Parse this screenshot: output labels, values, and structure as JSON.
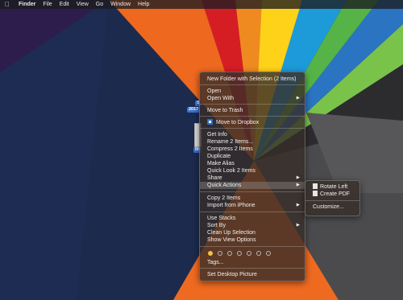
{
  "menubar": {
    "apple_icon": "apple-icon",
    "app": "Finder",
    "menus": [
      "File",
      "Edit",
      "View",
      "Go",
      "Window",
      "Help"
    ]
  },
  "desktop": {
    "labels": [
      "S",
      "2017",
      "IM"
    ]
  },
  "context_menu": {
    "new_folder": "New Folder with Selection (2 Items)",
    "open": "Open",
    "open_with": "Open With",
    "move_to_trash": "Move to Trash",
    "move_to_dropbox": "Move to Dropbox",
    "get_info": "Get Info",
    "rename": "Rename 2 Items...",
    "compress": "Compress 2 Items",
    "duplicate": "Duplicate",
    "make_alias": "Make Alias",
    "quick_look": "Quick Look 2 Items",
    "share": "Share",
    "quick_actions": "Quick Actions",
    "copy": "Copy 2 Items",
    "import_iphone": "Import from iPhone",
    "use_stacks": "Use Stacks",
    "sort_by": "Sort By",
    "clean_up": "Clean Up Selection",
    "show_view_options": "Show View Options",
    "tags": "Tags...",
    "set_desktop_picture": "Set Desktop Picture",
    "submenu_arrow": "▶"
  },
  "tag_colors": [
    "#f2c244",
    "#7a7a7a",
    "#7a7a7a",
    "#7a7a7a",
    "#7a7a7a",
    "#7a7a7a",
    "#7a7a7a"
  ],
  "submenu": {
    "rotate_left": "Rotate Left",
    "create_pdf": "Create PDF",
    "customize": "Customize..."
  }
}
